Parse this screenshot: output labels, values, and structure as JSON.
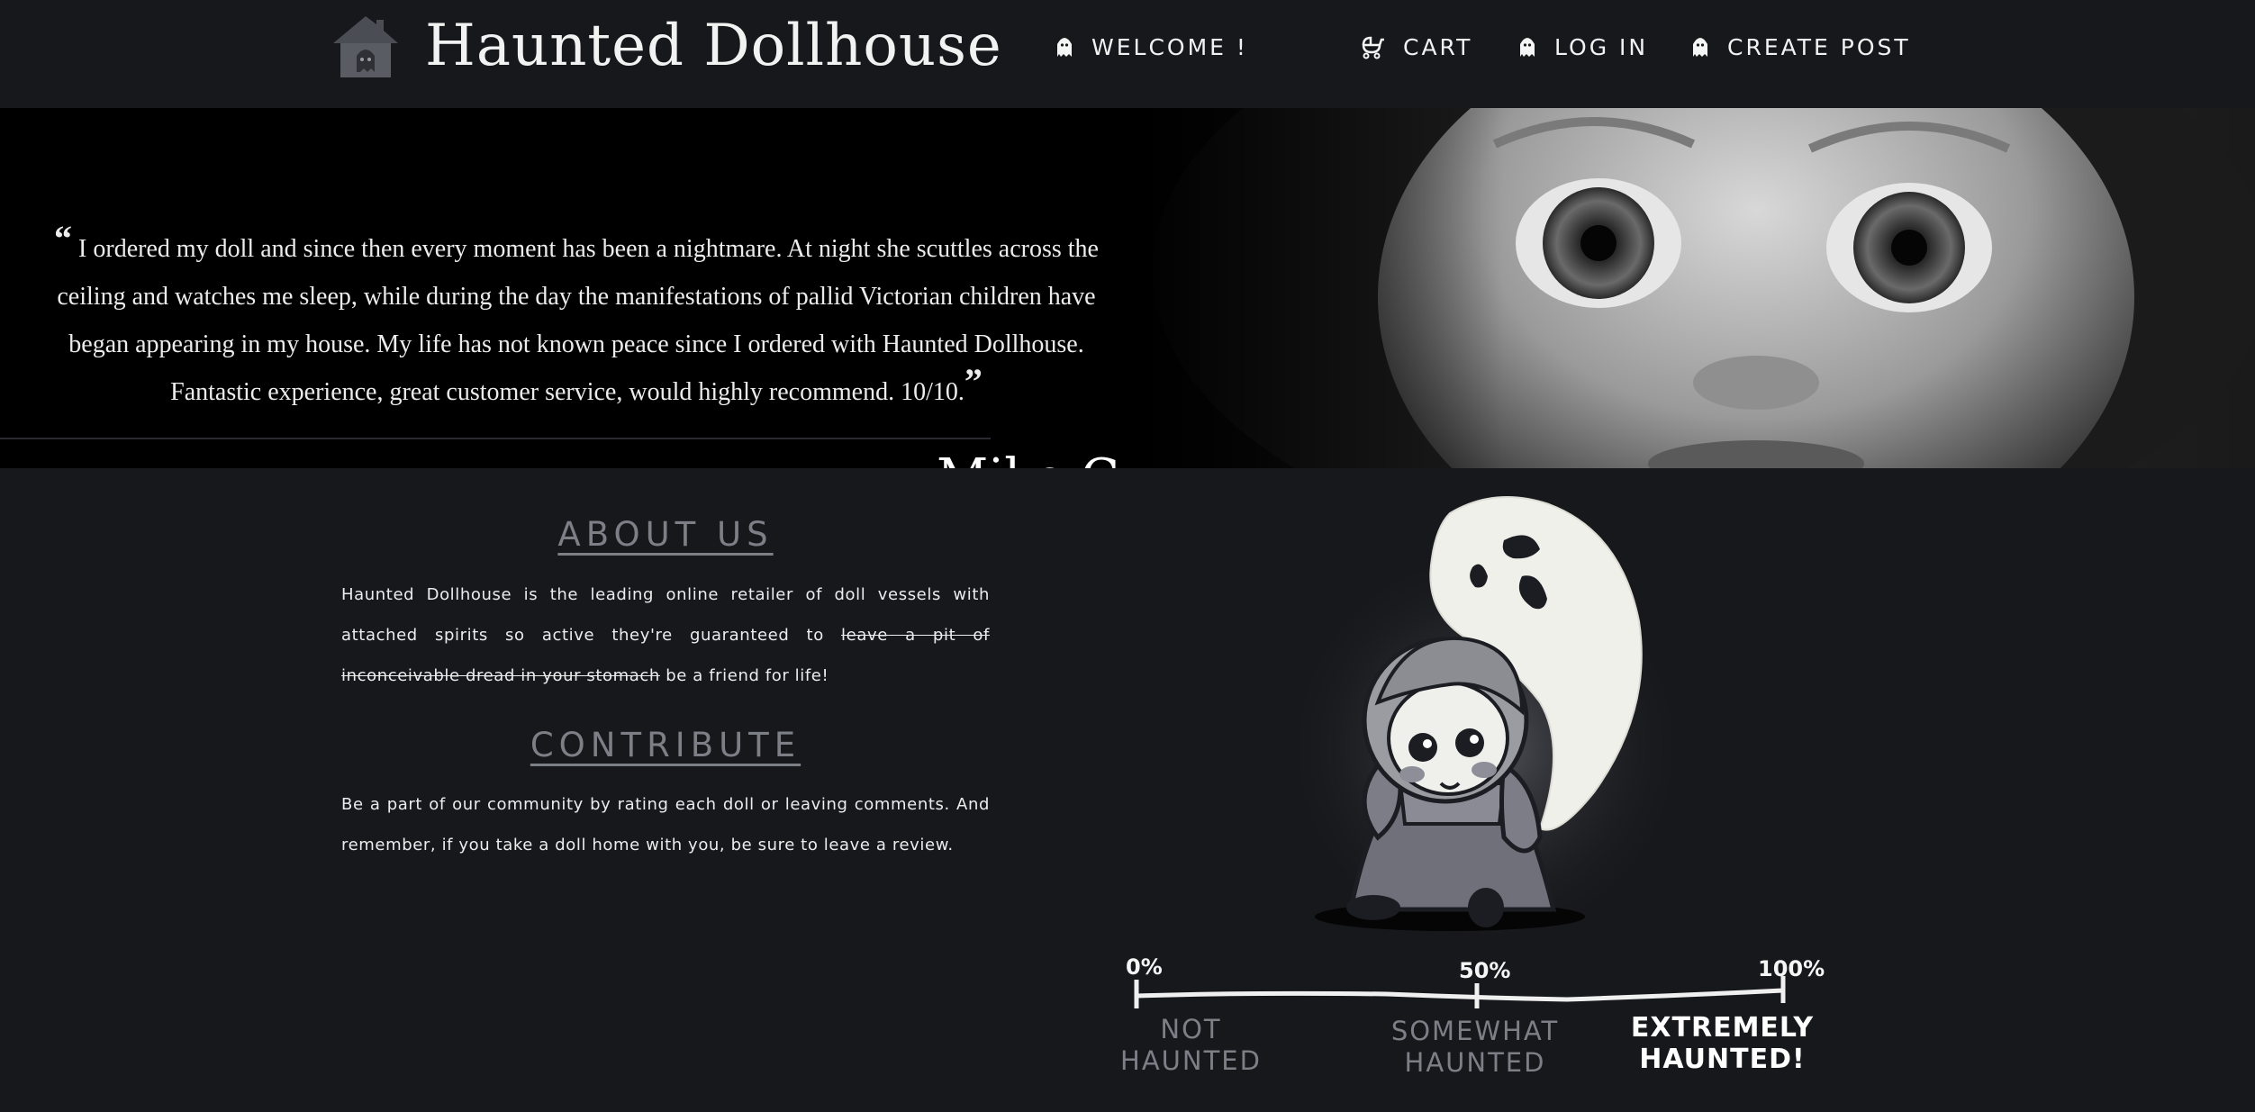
{
  "navbar": {
    "brand_title": "Haunted Dollhouse",
    "welcome": "WELCOME !",
    "cart": "CART",
    "login": "LOG IN",
    "create_post": "CREATE POST"
  },
  "hero": {
    "quote": "I ordered my doll and since then every moment has been a nightmare. At night she scuttles across the ceiling and watches me sleep, while during the day the manifestations of pallid Victorian children have began appearing in my house. My life has not known peace since I ordered with Haunted Dollhouse. Fantastic experience, great customer service, would highly recommend. 10/10.",
    "open_quote": "“",
    "close_quote": "”",
    "author": "Mike C."
  },
  "about": {
    "heading": "ABOUT US",
    "text_before": "Haunted Dollhouse is the leading online retailer of doll vessels with attached spirits so active they're guaranteed to ",
    "text_strike": "leave a pit of inconceivable dread in your stomach",
    "text_after": " be a friend for life!"
  },
  "contribute": {
    "heading": "CONTRIBUTE",
    "text": "Be a part of our community by rating each doll or leaving comments. And remember, if you take a doll home with you, be sure to leave a review."
  },
  "scale": {
    "pct_0": "0%",
    "pct_50": "50%",
    "pct_100": "100%",
    "not_line1": "NOT",
    "not_line2": "HAUNTED",
    "some_line1": "SOMEWHAT",
    "some_line2": "HAUNTED",
    "ext_line1": "EXTREMELY",
    "ext_line2": "HAUNTED!"
  },
  "colors": {
    "background": "#17181c",
    "heading_gray": "#7d7f87",
    "text": "#ececec"
  },
  "icons": [
    "house-ghost-icon",
    "ghost-icon",
    "stroller-cart-icon"
  ]
}
